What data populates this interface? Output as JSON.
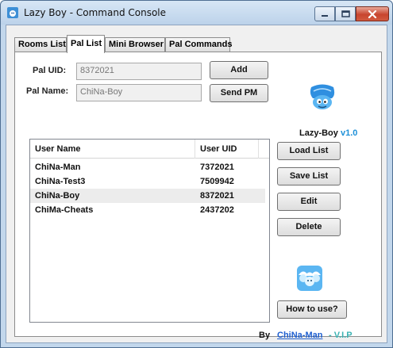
{
  "window": {
    "title": "Lazy Boy - Command Console",
    "icons": {
      "app": "smurf-app-icon",
      "minimize": "minimize-icon",
      "maximize": "maximize-icon",
      "close": "close-icon"
    }
  },
  "tabs": [
    {
      "label": "Rooms List",
      "active": false
    },
    {
      "label": "Pal List",
      "active": true
    },
    {
      "label": "Mini Browser",
      "active": false
    },
    {
      "label": "Pal Commands",
      "active": false
    }
  ],
  "form": {
    "uid_label": "Pal UID:",
    "uid_value": "8372021",
    "name_label": "Pal Name:",
    "name_value": "ChiNa-Boy",
    "add_label": "Add",
    "sendpm_label": "Send PM"
  },
  "brand": {
    "name": "Lazy-Boy",
    "version": "v1.0",
    "logo_icon": "smurf-logo-icon"
  },
  "list": {
    "columns": [
      "User Name",
      "User UID"
    ],
    "rows": [
      {
        "name": "ChiNa-Man",
        "uid": "7372021",
        "selected": false
      },
      {
        "name": "ChiNa-Test3",
        "uid": "7509942",
        "selected": false
      },
      {
        "name": "ChiNa-Boy",
        "uid": "8372021",
        "selected": true
      },
      {
        "name": "ChiMa-Cheats",
        "uid": "2437202",
        "selected": false
      }
    ]
  },
  "actions": {
    "load": "Load List",
    "save": "Save List",
    "edit": "Edit",
    "delete": "Delete",
    "howto": "How to use?",
    "group_icon": "group-smurf-icon"
  },
  "footer": {
    "by": "By",
    "author": "ChiNa-Man",
    "suffix": "- V.I.P"
  },
  "colors": {
    "accent": "#1e90d8",
    "link": "#1e5fd0",
    "vip": "#3cb3b3",
    "title_bar": "#c2d7ec"
  }
}
